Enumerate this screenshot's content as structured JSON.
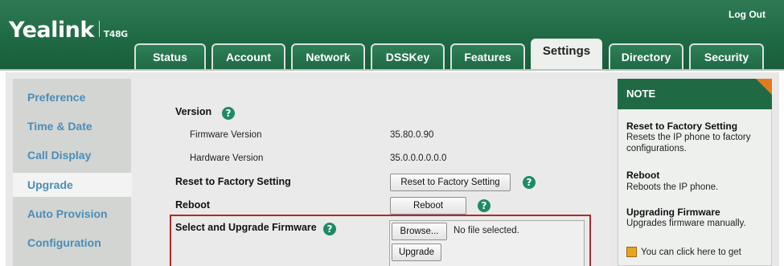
{
  "header": {
    "brand": "Yealink",
    "model": "T48G",
    "logout": "Log Out"
  },
  "tabs": [
    {
      "label": "Status"
    },
    {
      "label": "Account"
    },
    {
      "label": "Network"
    },
    {
      "label": "DSSKey"
    },
    {
      "label": "Features"
    },
    {
      "label": "Settings",
      "active": true
    },
    {
      "label": "Directory"
    },
    {
      "label": "Security"
    }
  ],
  "sidebar": {
    "items": [
      {
        "label": "Preference"
      },
      {
        "label": "Time & Date"
      },
      {
        "label": "Call Display"
      },
      {
        "label": "Upgrade",
        "active": true
      },
      {
        "label": "Auto Provision"
      },
      {
        "label": "Configuration"
      }
    ]
  },
  "main": {
    "version_label": "Version",
    "firmware_version_label": "Firmware Version",
    "firmware_version_value": "35.80.0.90",
    "hardware_version_label": "Hardware Version",
    "hardware_version_value": "35.0.0.0.0.0.0",
    "reset_label": "Reset to Factory Setting",
    "reset_button": "Reset to Factory Setting",
    "reboot_label": "Reboot",
    "reboot_button": "Reboot",
    "firmware_label": "Select and Upgrade Firmware",
    "browse_button": "Browse...",
    "file_status": "No file selected.",
    "upgrade_button": "Upgrade",
    "help_glyph": "?"
  },
  "note": {
    "title": "NOTE",
    "items": [
      {
        "heading": "Reset to Factory Setting",
        "text": "Resets the IP phone to factory configurations."
      },
      {
        "heading": "Reboot",
        "text": "Reboots the IP phone."
      },
      {
        "heading": "Upgrading Firmware",
        "text": "Upgrades firmware manually."
      }
    ],
    "footer": "You can click here to get"
  },
  "colors": {
    "brand_green": "#1f6a45",
    "link_blue": "#4b8db8",
    "highlight_red": "#b02a2a",
    "help_green": "#1f8a66",
    "note_orange": "#e07b1f"
  }
}
